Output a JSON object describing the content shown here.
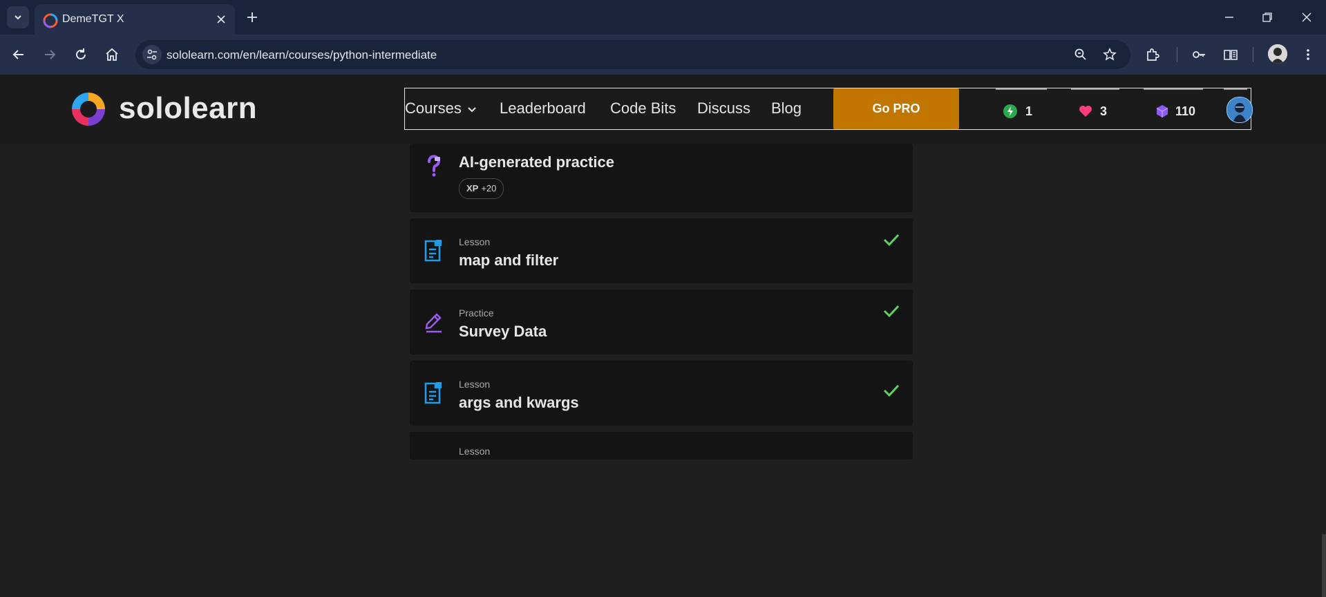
{
  "browser": {
    "tab_title": "DemeTGT X",
    "url": "sololearn.com/en/learn/courses/python-intermediate"
  },
  "site": {
    "logo_text": "sololearn",
    "nav": {
      "courses": "Courses",
      "leaderboard": "Leaderboard",
      "code_bits": "Code Bits",
      "discuss": "Discuss",
      "blog": "Blog"
    },
    "go_pro": "Go PRO",
    "stats": {
      "streak": "1",
      "hearts": "3",
      "gems": "110"
    }
  },
  "colors": {
    "accent_orange": "#c17600",
    "check_green": "#5fd35f",
    "lesson_blue": "#1f9be8",
    "practice_purple": "#9a5cf0",
    "heart_pink": "#ff3c7d"
  },
  "lessons": [
    {
      "label": "",
      "title": "AI-generated practice",
      "icon": "question-icon",
      "xp_label": "XP",
      "xp_value": "+20"
    },
    {
      "label": "Lesson",
      "title": "map and filter",
      "icon": "lesson-doc-icon",
      "done": true
    },
    {
      "label": "Practice",
      "title": "Survey Data",
      "icon": "practice-pencil-icon",
      "done": true
    },
    {
      "label": "Lesson",
      "title": "args and kwargs",
      "icon": "lesson-doc-icon",
      "done": true
    },
    {
      "label": "Lesson",
      "title": "",
      "icon": "lesson-doc-icon",
      "done": false
    }
  ]
}
